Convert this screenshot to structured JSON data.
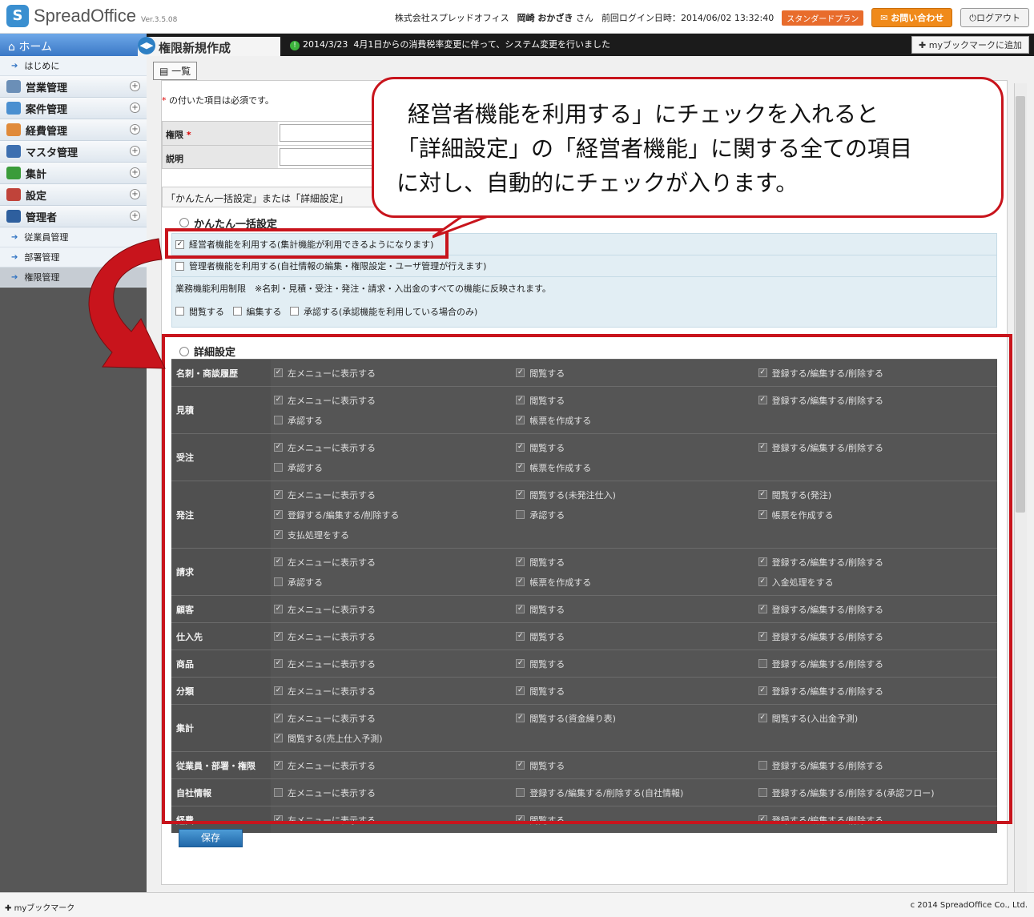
{
  "header": {
    "logo": "SpreadOffice",
    "version": "Ver.3.5.08",
    "company": "株式会社スプレッドオフィス",
    "user": "岡崎 おかざき",
    "user_suffix": "さん",
    "last_login_label": "前回ログイン日時：",
    "last_login": "2014/06/02 13:32:40",
    "plan": "スタンダードプラン",
    "contact": "お問い合わせ",
    "logout": "ログアウト"
  },
  "titlebar": {
    "home": "ホーム",
    "page_title": "権限新規作成",
    "news_date": "2014/3/23",
    "news": "4月1日からの消費税率変更に伴って、システム変更を行いました",
    "bookmark_add": "myブックマークに追加"
  },
  "sidebar": {
    "intro": "はじめに",
    "menus": [
      {
        "label": "営業管理",
        "color": "#6b8fb7"
      },
      {
        "label": "案件管理",
        "color": "#4a8fd0"
      },
      {
        "label": "経費管理",
        "color": "#e08a3a"
      },
      {
        "label": "マスタ管理",
        "color": "#3d6fb0"
      },
      {
        "label": "集計",
        "color": "#3a9c3a"
      },
      {
        "label": "設定",
        "color": "#c0433a"
      },
      {
        "label": "管理者",
        "color": "#2e5f9e"
      }
    ],
    "subs": [
      "従業員管理",
      "部署管理",
      "権限管理"
    ]
  },
  "content": {
    "list_btn": "一覧",
    "required_note": "の付いた項目は必須です。",
    "required_star": "*",
    "fields": [
      {
        "label": "権限",
        "required": true
      },
      {
        "label": "説明",
        "required": false
      }
    ],
    "mode_text": "「かんたん一括設定」または「詳細設定」",
    "easy_label": "かんたん一括設定",
    "easy_rows": [
      "経営者機能を利用する(集計機能が利用できるようになります)",
      "管理者機能を利用する(自社情報の編集・権限設定・ユーザ管理が行えます)",
      "業務機能利用制限　※名刺・見積・受注・発注・請求・入出金のすべての機能に反映されます。"
    ],
    "easy_perm": [
      "閲覧する",
      "編集する",
      "承認する(承認機能を利用している場合のみ)"
    ],
    "detail_label": "詳細設定",
    "save": "保存"
  },
  "detail_rows": [
    {
      "name": "名刺・商談履歴",
      "cells": [
        [
          "左メニューに表示する",
          true
        ],
        [
          "閲覧する",
          true
        ],
        [
          "登録する/編集する/削除する",
          true
        ]
      ]
    },
    {
      "name": "見積",
      "cells": [
        [
          "左メニューに表示する",
          true
        ],
        [
          "閲覧する",
          true
        ],
        [
          "登録する/編集する/削除する",
          true
        ],
        [
          "承認する",
          false
        ],
        [
          "帳票を作成する",
          true
        ]
      ]
    },
    {
      "name": "受注",
      "cells": [
        [
          "左メニューに表示する",
          true
        ],
        [
          "閲覧する",
          true
        ],
        [
          "登録する/編集する/削除する",
          true
        ],
        [
          "承認する",
          false
        ],
        [
          "帳票を作成する",
          true
        ]
      ]
    },
    {
      "name": "発注",
      "cells": [
        [
          "左メニューに表示する",
          true
        ],
        [
          "閲覧する(未発注仕入)",
          true
        ],
        [
          "閲覧する(発注)",
          true
        ],
        [
          "登録する/編集する/削除する",
          true
        ],
        [
          "承認する",
          false
        ],
        [
          "帳票を作成する",
          true
        ],
        [
          "支払処理をする",
          true
        ]
      ]
    },
    {
      "name": "請求",
      "cells": [
        [
          "左メニューに表示する",
          true
        ],
        [
          "閲覧する",
          true
        ],
        [
          "登録する/編集する/削除する",
          true
        ],
        [
          "承認する",
          false
        ],
        [
          "帳票を作成する",
          true
        ],
        [
          "入金処理をする",
          true
        ]
      ]
    },
    {
      "name": "顧客",
      "cells": [
        [
          "左メニューに表示する",
          true
        ],
        [
          "閲覧する",
          true
        ],
        [
          "登録する/編集する/削除する",
          true
        ]
      ]
    },
    {
      "name": "仕入先",
      "cells": [
        [
          "左メニューに表示する",
          true
        ],
        [
          "閲覧する",
          true
        ],
        [
          "登録する/編集する/削除する",
          true
        ]
      ]
    },
    {
      "name": "商品",
      "cells": [
        [
          "左メニューに表示する",
          true
        ],
        [
          "閲覧する",
          true
        ],
        [
          "登録する/編集する/削除する",
          false
        ]
      ]
    },
    {
      "name": "分類",
      "cells": [
        [
          "左メニューに表示する",
          true
        ],
        [
          "閲覧する",
          true
        ],
        [
          "登録する/編集する/削除する",
          true
        ]
      ]
    },
    {
      "name": "集計",
      "cells": [
        [
          "左メニューに表示する",
          true
        ],
        [
          "閲覧する(資金繰り表)",
          true
        ],
        [
          "閲覧する(入出金予測)",
          true
        ],
        [
          "閲覧する(売上仕入予測)",
          true
        ]
      ]
    },
    {
      "name": "従業員・部署・権限",
      "cells": [
        [
          "左メニューに表示する",
          true
        ],
        [
          "閲覧する",
          true
        ],
        [
          "登録する/編集する/削除する",
          false
        ]
      ]
    },
    {
      "name": "自社情報",
      "cells": [
        [
          "左メニューに表示する",
          false
        ],
        [
          "登録する/編集する/削除する(自社情報)",
          false
        ],
        [
          "登録する/編集する/削除する(承認フロー)",
          false
        ]
      ]
    },
    {
      "name": "経費",
      "cells": [
        [
          "左メニューに表示する",
          true
        ],
        [
          "閲覧する",
          true
        ],
        [
          "登録する/編集する/削除する",
          true
        ]
      ]
    }
  ],
  "annotation": {
    "line1": "経営者機能を利用する」にチェックを入れると",
    "line2": "「詳細設定」の「経営者機能」に関する全ての項目",
    "line3": "に対し、自動的にチェックが入ります。"
  },
  "footer": {
    "bookmark": "myブックマーク",
    "copyright": "c 2014 SpreadOffice Co., Ltd."
  }
}
